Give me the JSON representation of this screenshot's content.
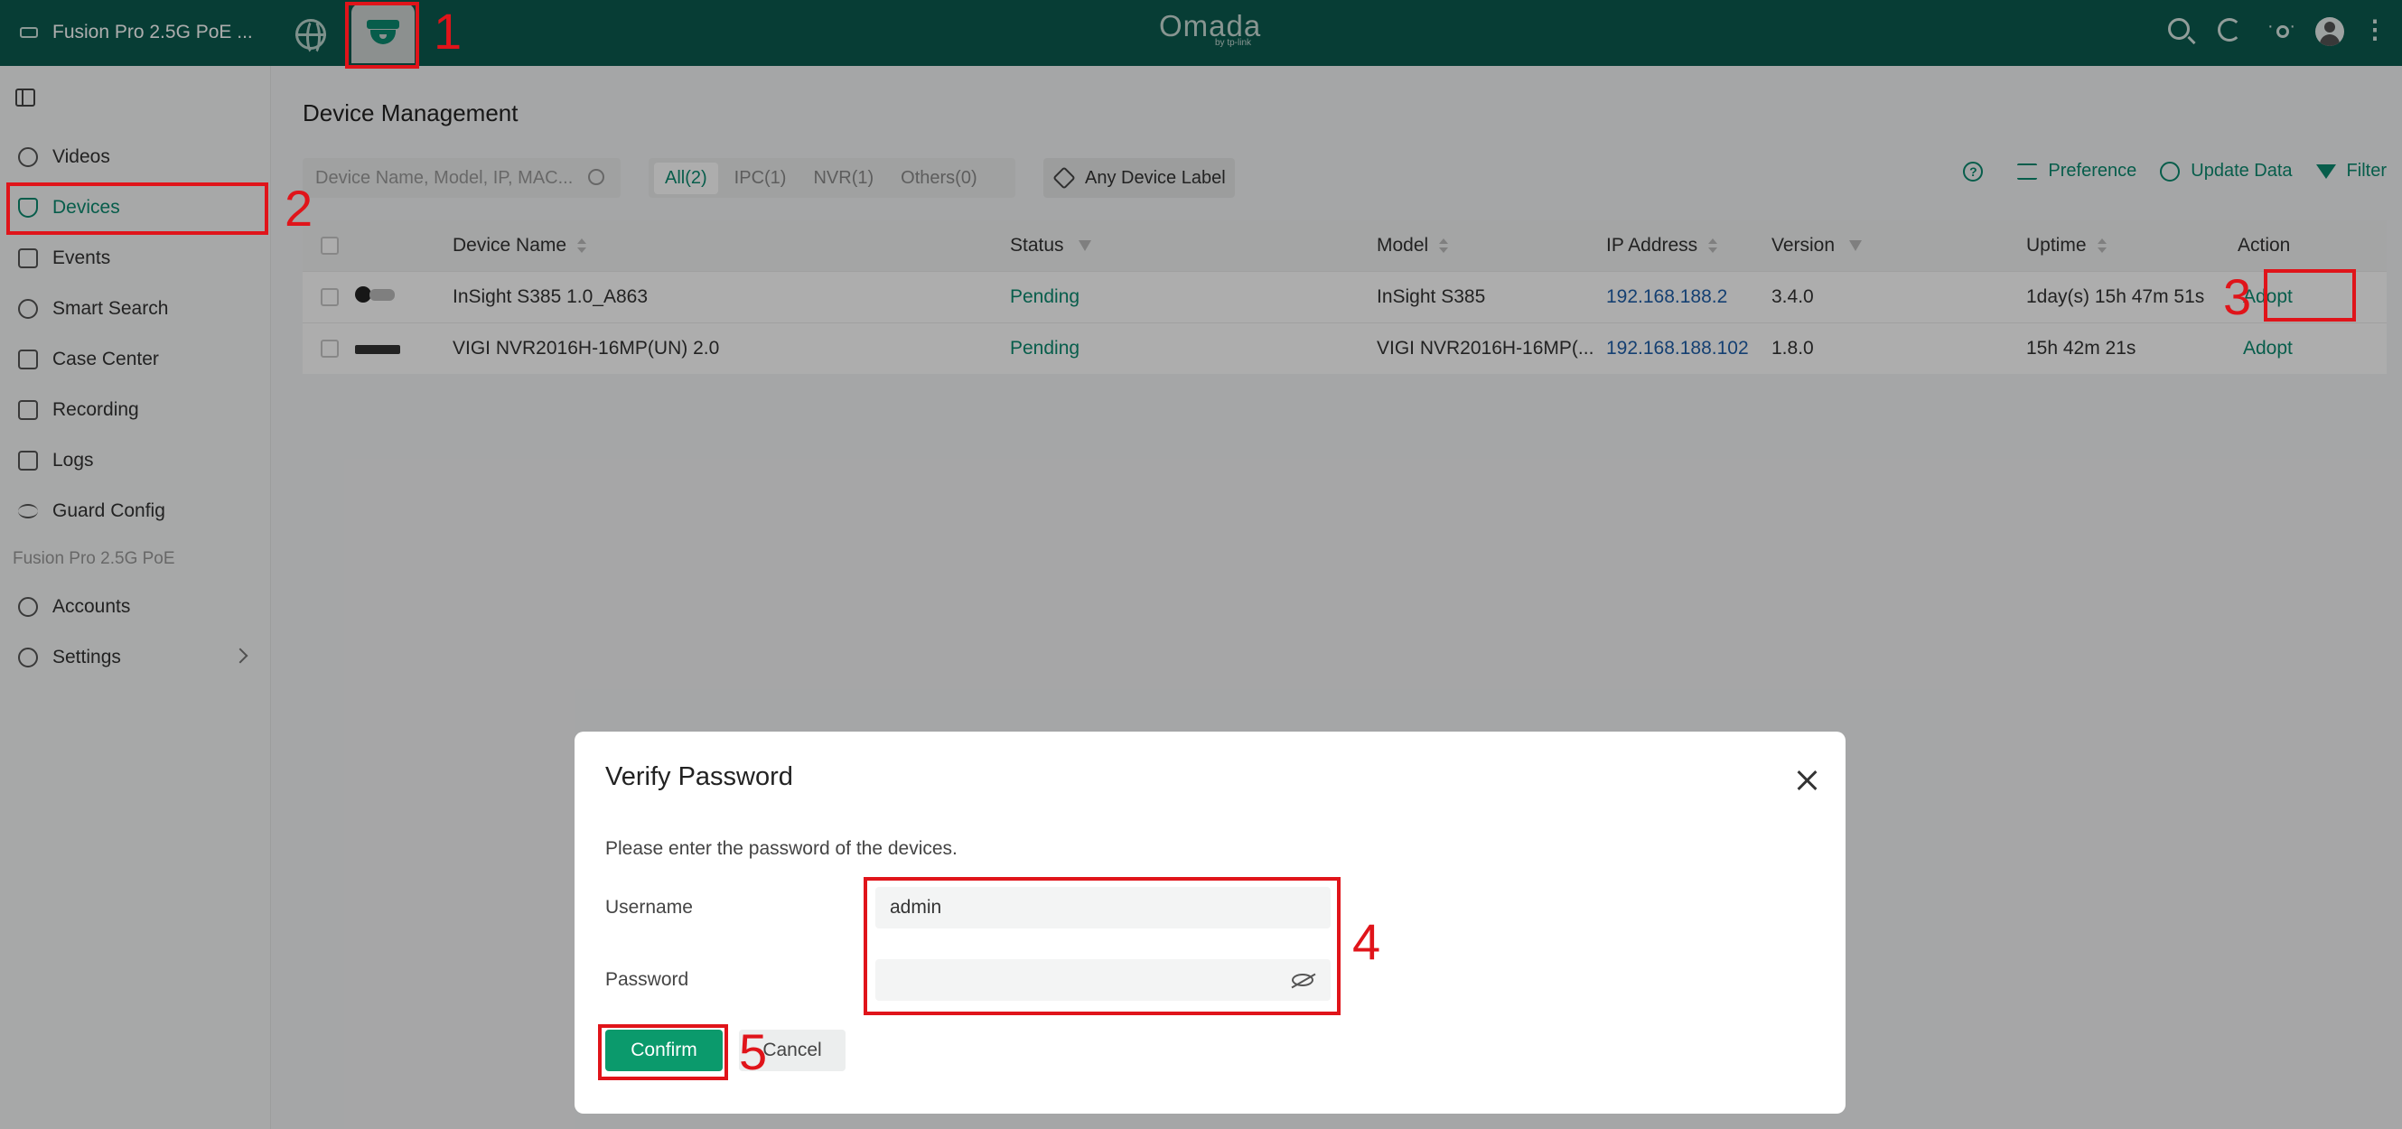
{
  "topbar": {
    "site_name": "Fusion Pro 2.5G PoE ...",
    "logo": "Omada",
    "logo_sub": "by tp-link"
  },
  "sidebar": {
    "items": [
      {
        "label": "Videos",
        "icon": "play-circle-icon"
      },
      {
        "label": "Devices",
        "icon": "camera-icon",
        "active": true
      },
      {
        "label": "Events",
        "icon": "events-icon"
      },
      {
        "label": "Smart Search",
        "icon": "smart-search-icon"
      },
      {
        "label": "Case Center",
        "icon": "case-icon"
      },
      {
        "label": "Recording",
        "icon": "recording-icon"
      },
      {
        "label": "Logs",
        "icon": "logs-icon"
      },
      {
        "label": "Guard Config",
        "icon": "sliders-icon"
      }
    ],
    "section": "Fusion Pro 2.5G PoE",
    "items2": [
      {
        "label": "Accounts",
        "icon": "user-icon"
      },
      {
        "label": "Settings",
        "icon": "gear-icon"
      }
    ]
  },
  "main": {
    "title": "Device Management",
    "search_placeholder": "Device Name, Model, IP, MAC...",
    "tabs": [
      "All(2)",
      "IPC(1)",
      "NVR(1)",
      "Others(0)"
    ],
    "label_button": "Any Device Label",
    "toolbar": {
      "preference": "Preference",
      "update": "Update Data",
      "filter": "Filter"
    },
    "columns": [
      "Device Name",
      "Status",
      "Model",
      "IP Address",
      "Version",
      "Uptime",
      "Action"
    ],
    "rows": [
      {
        "name": "InSight S385 1.0_A863",
        "status": "Pending",
        "model": "InSight S385",
        "ip": "192.168.188.2",
        "version": "3.4.0",
        "uptime": "1day(s) 15h 47m 51s",
        "action": "Adopt"
      },
      {
        "name": "VIGI NVR2016H-16MP(UN) 2.0",
        "status": "Pending",
        "model": "VIGI NVR2016H-16MP(...",
        "ip": "192.168.188.102",
        "version": "1.8.0",
        "uptime": "15h 42m 21s",
        "action": "Adopt"
      }
    ]
  },
  "dialog": {
    "title": "Verify Password",
    "desc": "Please enter the password of the devices.",
    "username_label": "Username",
    "username_value": "admin",
    "password_label": "Password",
    "confirm": "Confirm",
    "cancel": "Cancel"
  },
  "annotations": [
    "1",
    "2",
    "3",
    "4",
    "5"
  ],
  "colors": {
    "topbar": "#0b5a4e",
    "accent": "#0b8a6f",
    "annotation": "#e0141a"
  }
}
